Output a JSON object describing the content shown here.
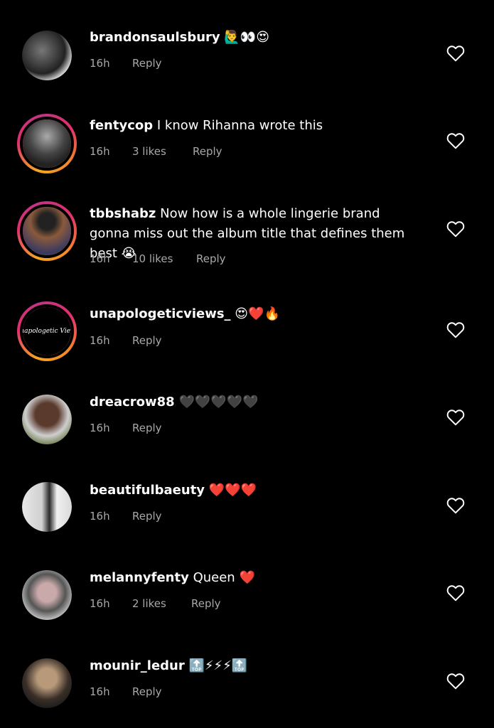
{
  "colors": {
    "background": "#000000",
    "text": "#ffffff",
    "meta": "#a8a8a8"
  },
  "comments": [
    {
      "username": "brandonsaulsbury",
      "text": "",
      "emoji": "🙋‍♂️👀😍",
      "time": "16h",
      "likes": "",
      "reply": "Reply",
      "avatar_ring": false,
      "avatar_label": ""
    },
    {
      "username": "fentycop",
      "text": "I know Rihanna wrote this",
      "emoji": "",
      "time": "16h",
      "likes": "3 likes",
      "reply": "Reply",
      "avatar_ring": true,
      "avatar_label": ""
    },
    {
      "username": "tbbshabz",
      "text": "Now how is a whole lingerie brand gonna miss out the album title that defines them best",
      "emoji": "😭",
      "time": "16h",
      "likes": "10 likes",
      "reply": "Reply",
      "avatar_ring": true,
      "avatar_label": ""
    },
    {
      "username": "unapologeticviews_",
      "text": "",
      "emoji": "😍❤️🔥",
      "time": "16h",
      "likes": "",
      "reply": "Reply",
      "avatar_ring": true,
      "avatar_label": "Unapologetic Views"
    },
    {
      "username": "dreacrow88",
      "text": "",
      "emoji": "🖤🖤🖤🖤🖤",
      "time": "16h",
      "likes": "",
      "reply": "Reply",
      "avatar_ring": false,
      "avatar_label": ""
    },
    {
      "username": "beautifulbaeuty",
      "text": "",
      "emoji": "❤️❤️❤️",
      "time": "16h",
      "likes": "",
      "reply": "Reply",
      "avatar_ring": false,
      "avatar_label": ""
    },
    {
      "username": "melannyfenty",
      "text": "Queen",
      "emoji": "❤️",
      "time": "16h",
      "likes": "2 likes",
      "reply": "Reply",
      "avatar_ring": false,
      "avatar_label": ""
    },
    {
      "username": "mounir_ledur",
      "text": "",
      "emoji": "🔝⚡⚡⚡🔝",
      "time": "16h",
      "likes": "",
      "reply": "Reply",
      "avatar_ring": false,
      "avatar_label": ""
    }
  ]
}
